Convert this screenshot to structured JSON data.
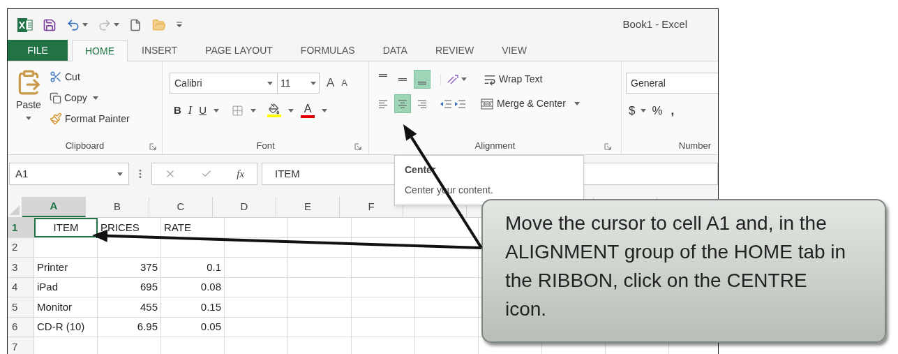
{
  "window": {
    "title": "Book1 - Excel"
  },
  "tabs": [
    {
      "label": "FILE",
      "kind": "file",
      "selected": false
    },
    {
      "label": "HOME",
      "kind": "tab",
      "selected": true
    },
    {
      "label": "INSERT",
      "kind": "tab",
      "selected": false
    },
    {
      "label": "PAGE LAYOUT",
      "kind": "tab",
      "selected": false
    },
    {
      "label": "FORMULAS",
      "kind": "tab",
      "selected": false
    },
    {
      "label": "DATA",
      "kind": "tab",
      "selected": false
    },
    {
      "label": "REVIEW",
      "kind": "tab",
      "selected": false
    },
    {
      "label": "VIEW",
      "kind": "tab",
      "selected": false
    }
  ],
  "ribbon": {
    "clipboard": {
      "paste": "Paste",
      "cut": "Cut",
      "copy": "Copy",
      "format_painter": "Format Painter",
      "label": "Clipboard"
    },
    "font": {
      "font_name": "Calibri",
      "font_size": "11",
      "size_buttons": [
        "A",
        "A"
      ],
      "styles": [
        "B",
        "I",
        "U"
      ],
      "font_color": "A",
      "label": "Font"
    },
    "alignment": {
      "vertical": [
        {
          "selected": false
        },
        {
          "selected": false
        },
        {
          "selected": true
        }
      ],
      "horizontal": [
        {
          "selected": false
        },
        {
          "selected": true
        },
        {
          "selected": false
        }
      ],
      "wrap_text": "Wrap Text",
      "merge": "Merge & Center",
      "label": "Alignment"
    },
    "number": {
      "format": "General",
      "currency": "$",
      "percent": "%",
      "comma": ",",
      "label": "Number"
    }
  },
  "formula_bar": {
    "name_box": "A1",
    "function_label": "fx",
    "formula": "ITEM"
  },
  "tooltip": {
    "title": "Center",
    "text": "Center your content."
  },
  "sheet": {
    "columns": [
      {
        "label": "A",
        "selected": true
      },
      {
        "label": "B",
        "selected": false
      },
      {
        "label": "C",
        "selected": false
      },
      {
        "label": "D",
        "selected": false
      },
      {
        "label": "E",
        "selected": false
      },
      {
        "label": "F",
        "selected": false
      }
    ],
    "rows": [
      {
        "label": "1",
        "selected": true,
        "cells": [
          {
            "text": "ITEM",
            "kind": "centered",
            "selected": true
          },
          {
            "text": "PRICES",
            "kind": "text",
            "selected": false
          },
          {
            "text": "RATE",
            "kind": "text",
            "selected": false
          }
        ]
      },
      {
        "label": "2",
        "selected": false,
        "cells": []
      },
      {
        "label": "3",
        "selected": false,
        "cells": [
          {
            "text": "Printer",
            "kind": "text",
            "selected": false
          },
          {
            "text": "375",
            "kind": "number",
            "selected": false
          },
          {
            "text": "0.1",
            "kind": "number",
            "selected": false
          }
        ]
      },
      {
        "label": "4",
        "selected": false,
        "cells": [
          {
            "text": "iPad",
            "kind": "text",
            "selected": false
          },
          {
            "text": "695",
            "kind": "number",
            "selected": false
          },
          {
            "text": "0.08",
            "kind": "number",
            "selected": false
          }
        ]
      },
      {
        "label": "5",
        "selected": false,
        "cells": [
          {
            "text": "Monitor",
            "kind": "text",
            "selected": false
          },
          {
            "text": "455",
            "kind": "number",
            "selected": false
          },
          {
            "text": "0.15",
            "kind": "number",
            "selected": false
          }
        ]
      },
      {
        "label": "6",
        "selected": false,
        "cells": [
          {
            "text": "CD-R (10)",
            "kind": "text",
            "selected": false
          },
          {
            "text": "6.95",
            "kind": "number",
            "selected": false
          },
          {
            "text": "0.05",
            "kind": "number",
            "selected": false
          }
        ]
      },
      {
        "label": "7",
        "selected": false,
        "cells": []
      }
    ]
  },
  "callout": {
    "text": "Move the cursor to cell A1 and, in the ALIGNMENT group of the HOME tab in the RIBBON, click on the CENTRE icon."
  }
}
